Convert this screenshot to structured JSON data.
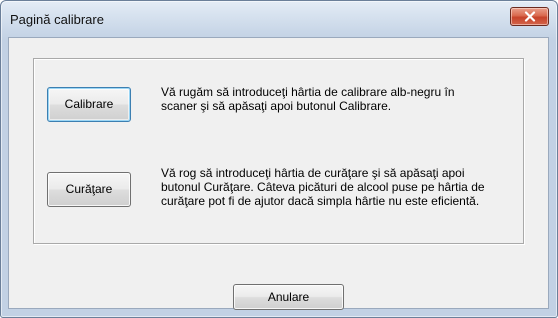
{
  "window": {
    "title": "Pagină calibrare"
  },
  "calibration": {
    "button_label": "Calibrare",
    "description": "Vă rugăm să introduceţi hârtia de calibrare alb-negru în scaner şi să apăsaţi apoi butonul Calibrare."
  },
  "cleaning": {
    "button_label": "Curăţare",
    "description": "Vă rog să introduceţi hârtia de curăţare şi să apăsaţi apoi butonul Curăţare. Câteva picături de alcool puse pe hârtia de curăţare pot fi de ajutor dacă simpla hârtie nu este eficientă."
  },
  "footer": {
    "cancel_label": "Anulare"
  },
  "icons": {
    "close": "close-icon"
  },
  "colors": {
    "close_button": "#d9694e",
    "client_background": "#f0f0f0",
    "focus_border": "#3c7fb1"
  }
}
